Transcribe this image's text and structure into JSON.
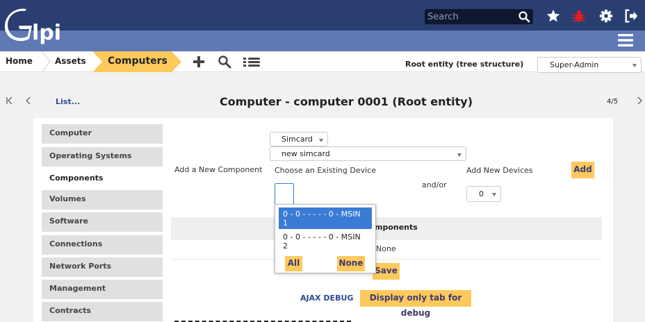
{
  "header": {
    "logo_text": "Glpi",
    "search_placeholder": "Search",
    "icons": [
      "star-icon",
      "bug-icon",
      "gear-icon",
      "logout-icon",
      "menu-icon"
    ]
  },
  "breadcrumb": {
    "home": "Home",
    "assets": "Assets",
    "current": "Computers",
    "tools": [
      "plus-icon",
      "search-icon",
      "list-icon"
    ]
  },
  "entity": {
    "label": "Root entity (tree structure)",
    "profile": "Super-Admin"
  },
  "nav": {
    "list_link": "List...",
    "title": "Computer - computer 0001 (Root entity)",
    "counter": "4/5"
  },
  "tabs": [
    {
      "label": "Computer",
      "active": false
    },
    {
      "label": "Operating Systems",
      "active": false
    },
    {
      "label": "Components",
      "active": true
    },
    {
      "label": "Volumes",
      "active": false
    },
    {
      "label": "Software",
      "active": false
    },
    {
      "label": "Connections",
      "active": false
    },
    {
      "label": "Network Ports",
      "active": false
    },
    {
      "label": "Management",
      "active": false
    },
    {
      "label": "Contracts",
      "active": false
    }
  ],
  "components": {
    "type_select": "Simcard",
    "item_select": "new simcard",
    "add_new_component_label": "Add a New Component",
    "choose_existing_label": "Choose an Existing Device",
    "and_or_label": "and/or",
    "add_new_devices_label": "Add New Devices",
    "add_button": "Add",
    "new_devices_count": "0",
    "table_header_partial": "mponents",
    "none_text": "None",
    "save_button": "Save"
  },
  "device_dropdown": {
    "options": [
      {
        "label": "0 - 0 - - - - - 0 - MSIN 1",
        "selected": true
      },
      {
        "label": "0 - 0 - - - - - 0 - MSIN 2",
        "selected": false
      }
    ],
    "all_button": "All",
    "none_button": "None"
  },
  "debug": {
    "ajax_label": "AJAX DEBUG",
    "tab_only_button": "Display only tab for debug"
  },
  "colors": {
    "header_dark": "#2a3e72",
    "header_band": "#5f79b5",
    "accent": "#fec95c",
    "link": "#2d4a95",
    "selected": "#3a7bd5"
  }
}
